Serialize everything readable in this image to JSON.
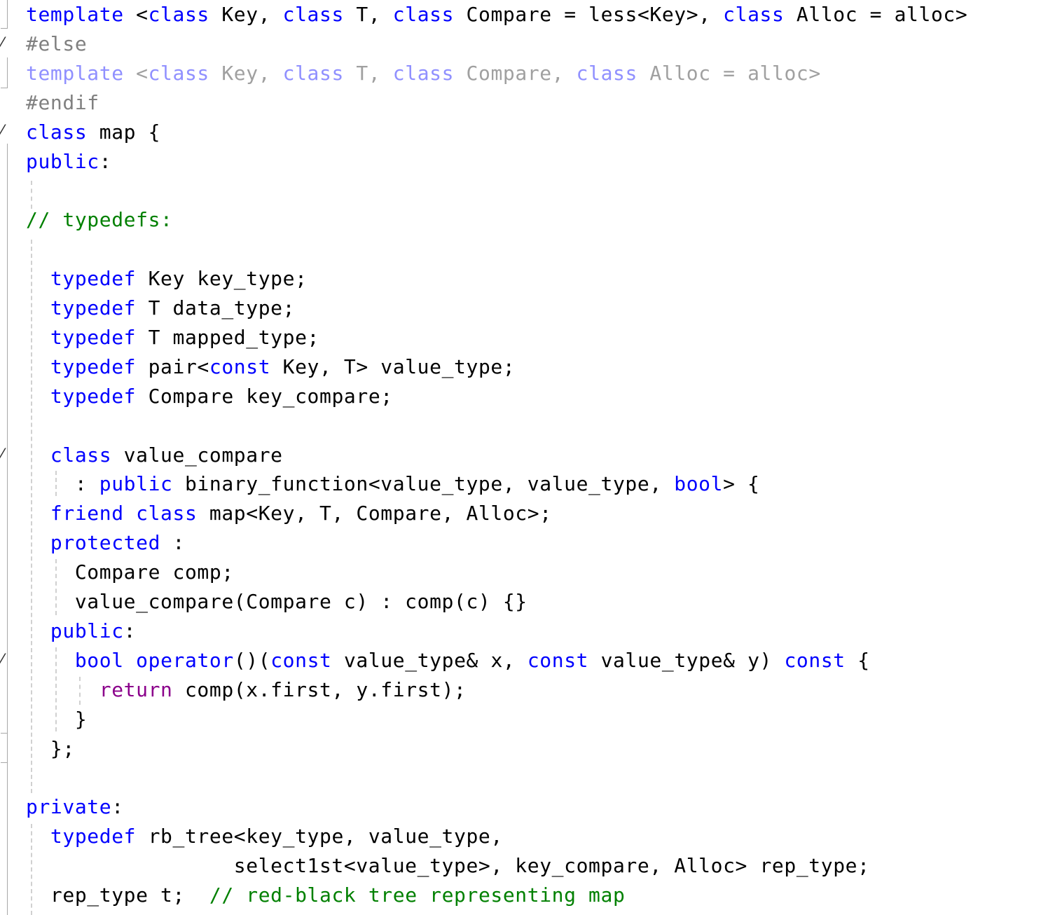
{
  "colors": {
    "keyword": "#0000ff",
    "preprocessor": "#808080",
    "inactive_text": "#a0a0a0",
    "inactive_keyword": "#9090ff",
    "comment": "#008000",
    "control_keyword": "#8b008b",
    "text": "#000000",
    "background": "#ffffff"
  },
  "lines": [
    {
      "tokens": [
        [
          "kw",
          "template"
        ],
        [
          "t",
          " <"
        ],
        [
          "kw",
          "class"
        ],
        [
          "t",
          " Key, "
        ],
        [
          "kw",
          "class"
        ],
        [
          "t",
          " T, "
        ],
        [
          "kw",
          "class"
        ],
        [
          "t",
          " Compare = less<Key>, "
        ],
        [
          "kw",
          "class"
        ],
        [
          "t",
          " Alloc = alloc>"
        ]
      ]
    },
    {
      "tokens": [
        [
          "pp",
          "#else"
        ]
      ]
    },
    {
      "tokens": [
        [
          "dimkw",
          "template"
        ],
        [
          "dim",
          " <"
        ],
        [
          "dimkw",
          "class"
        ],
        [
          "dim",
          " Key, "
        ],
        [
          "dimkw",
          "class"
        ],
        [
          "dim",
          " T, "
        ],
        [
          "dimkw",
          "class"
        ],
        [
          "dim",
          " Compare, "
        ],
        [
          "dimkw",
          "class"
        ],
        [
          "dim",
          " Alloc = alloc>"
        ]
      ]
    },
    {
      "tokens": [
        [
          "pp",
          "#endif"
        ]
      ]
    },
    {
      "tokens": [
        [
          "kw",
          "class"
        ],
        [
          "t",
          " map {"
        ]
      ]
    },
    {
      "tokens": [
        [
          "kw",
          "public"
        ],
        [
          "t",
          ":"
        ]
      ]
    },
    {
      "tokens": []
    },
    {
      "tokens": [
        [
          "cm",
          "// typedefs:"
        ]
      ]
    },
    {
      "tokens": []
    },
    {
      "tokens": [
        [
          "t",
          "  "
        ],
        [
          "kw",
          "typedef"
        ],
        [
          "t",
          " Key key_type;"
        ]
      ]
    },
    {
      "tokens": [
        [
          "t",
          "  "
        ],
        [
          "kw",
          "typedef"
        ],
        [
          "t",
          " T data_type;"
        ]
      ]
    },
    {
      "tokens": [
        [
          "t",
          "  "
        ],
        [
          "kw",
          "typedef"
        ],
        [
          "t",
          " T mapped_type;"
        ]
      ]
    },
    {
      "tokens": [
        [
          "t",
          "  "
        ],
        [
          "kw",
          "typedef"
        ],
        [
          "t",
          " pair<"
        ],
        [
          "kw",
          "const"
        ],
        [
          "t",
          " Key, T> value_type;"
        ]
      ]
    },
    {
      "tokens": [
        [
          "t",
          "  "
        ],
        [
          "kw",
          "typedef"
        ],
        [
          "t",
          " Compare key_compare;"
        ]
      ]
    },
    {
      "tokens": []
    },
    {
      "tokens": [
        [
          "t",
          "  "
        ],
        [
          "kw",
          "class"
        ],
        [
          "t",
          " value_compare"
        ]
      ]
    },
    {
      "tokens": [
        [
          "t",
          "    : "
        ],
        [
          "kw",
          "public"
        ],
        [
          "t",
          " binary_function<value_type, value_type, "
        ],
        [
          "kw",
          "bool"
        ],
        [
          "t",
          "> {"
        ]
      ]
    },
    {
      "tokens": [
        [
          "t",
          "  "
        ],
        [
          "kw",
          "friend"
        ],
        [
          "t",
          " "
        ],
        [
          "kw",
          "class"
        ],
        [
          "t",
          " map<Key, T, Compare, Alloc>;"
        ]
      ]
    },
    {
      "tokens": [
        [
          "t",
          "  "
        ],
        [
          "kw",
          "protected"
        ],
        [
          "t",
          " :"
        ]
      ]
    },
    {
      "tokens": [
        [
          "t",
          "    Compare comp;"
        ]
      ]
    },
    {
      "tokens": [
        [
          "t",
          "    value_compare(Compare c) : comp(c) {}"
        ]
      ]
    },
    {
      "tokens": [
        [
          "t",
          "  "
        ],
        [
          "kw",
          "public"
        ],
        [
          "t",
          ":"
        ]
      ]
    },
    {
      "tokens": [
        [
          "t",
          "    "
        ],
        [
          "kw",
          "bool"
        ],
        [
          "t",
          " "
        ],
        [
          "kw",
          "operator"
        ],
        [
          "t",
          "()("
        ],
        [
          "kw",
          "const"
        ],
        [
          "t",
          " value_type& x, "
        ],
        [
          "kw",
          "const"
        ],
        [
          "t",
          " value_type& y) "
        ],
        [
          "kw",
          "const"
        ],
        [
          "t",
          " {"
        ]
      ]
    },
    {
      "tokens": [
        [
          "t",
          "      "
        ],
        [
          "ret",
          "return"
        ],
        [
          "t",
          " comp(x.first, y.first);"
        ]
      ]
    },
    {
      "tokens": [
        [
          "t",
          "    }"
        ]
      ]
    },
    {
      "tokens": [
        [
          "t",
          "  };"
        ]
      ]
    },
    {
      "tokens": []
    },
    {
      "tokens": [
        [
          "kw",
          "private"
        ],
        [
          "t",
          ":"
        ]
      ]
    },
    {
      "tokens": [
        [
          "t",
          "  "
        ],
        [
          "kw",
          "typedef"
        ],
        [
          "t",
          " rb_tree<key_type, value_type,"
        ]
      ]
    },
    {
      "tokens": [
        [
          "t",
          "                 select1st<value_type>, key_compare, Alloc> rep_type;"
        ]
      ]
    },
    {
      "tokens": [
        [
          "t",
          "  rep_type t;  "
        ],
        [
          "cm",
          "// red-black tree representing map"
        ]
      ]
    }
  ]
}
